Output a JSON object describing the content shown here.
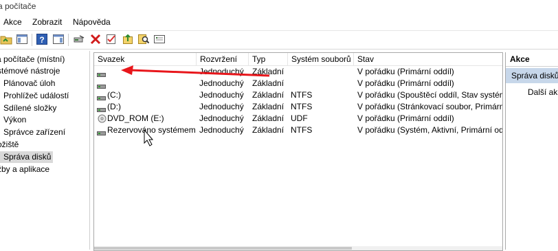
{
  "window": {
    "title": "a počítače"
  },
  "menu": {
    "items": [
      "Akce",
      "Zobrazit",
      "Nápověda"
    ]
  },
  "toolbar": {
    "buttons": [
      "folder-up-icon",
      "show-hide-tree-icon",
      "help-icon",
      "show-hide-action-pane-icon",
      "connect-icon",
      "delete-icon",
      "properties-icon",
      "open-icon",
      "search-icon",
      "console-icon"
    ]
  },
  "tree": {
    "items": [
      {
        "label": "a počítače (místní)"
      },
      {
        "label": "stémové nástroje"
      },
      {
        "label": "Plánovač úloh"
      },
      {
        "label": "Prohlížeč událostí"
      },
      {
        "label": "Sdílené složky"
      },
      {
        "label": "Výkon"
      },
      {
        "label": "Správce zařízení"
      },
      {
        "label": "ožiště"
      },
      {
        "label": "Správa disků"
      },
      {
        "label": "žby a aplikace"
      }
    ]
  },
  "volumes": {
    "columns": [
      "Svazek",
      "Rozvržení",
      "Typ",
      "Systém souborů",
      "Stav"
    ],
    "rows": [
      {
        "volume": "",
        "layout": "Jednoduchý",
        "type": "Základní",
        "fs": "",
        "status": "V pořádku (Primární oddíl)",
        "icon": "drive-icon"
      },
      {
        "volume": "",
        "layout": "Jednoduchý",
        "type": "Základní",
        "fs": "",
        "status": "V pořádku (Primární oddíl)",
        "icon": "drive-icon"
      },
      {
        "volume": "(C:)",
        "layout": "Jednoduchý",
        "type": "Základní",
        "fs": "NTFS",
        "status": "V pořádku (Spouštěcí oddíl, Stav systém",
        "icon": "drive-icon"
      },
      {
        "volume": "(D:)",
        "layout": "Jednoduchý",
        "type": "Základní",
        "fs": "NTFS",
        "status": "V pořádku (Stránkovací soubor, Primárn",
        "icon": "drive-icon"
      },
      {
        "volume": "DVD_ROM (E:)",
        "layout": "Jednoduchý",
        "type": "Základní",
        "fs": "UDF",
        "status": "V pořádku (Primární oddíl)",
        "icon": "dvd-icon"
      },
      {
        "volume": "Rezervováno systémem",
        "layout": "Jednoduchý",
        "type": "Základní",
        "fs": "NTFS",
        "status": "V pořádku (Systém, Aktivní, Primární od",
        "icon": "drive-icon"
      }
    ]
  },
  "actions": {
    "header": "Akce",
    "section": "Správa disků",
    "item": "Další akce"
  },
  "annotation": {
    "color": "#e8161b"
  }
}
